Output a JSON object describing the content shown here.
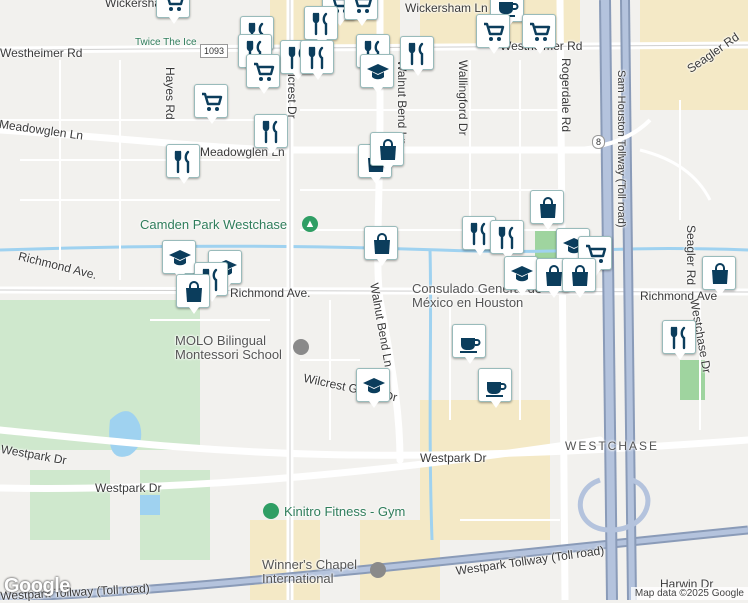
{
  "map": {
    "roads": [
      {
        "name": "Westheimer Rd"
      },
      {
        "name": "Wickersham Ln"
      },
      {
        "name": "Wickersham Ln"
      },
      {
        "name": "Westheimer Rd"
      },
      {
        "name": "Meadowglen Ln"
      },
      {
        "name": "Meadowglen Ln"
      },
      {
        "name": "Hayes Rd"
      },
      {
        "name": "Wilcrest Dr"
      },
      {
        "name": "Walnut Bend Ln"
      },
      {
        "name": "Wallingford Dr"
      },
      {
        "name": "Rogerdale Rd"
      },
      {
        "name": "Sam Houston Tollway (Toll road)"
      },
      {
        "name": "Seagler Rd"
      },
      {
        "name": "Seagler Rd"
      },
      {
        "name": "Richmond Ave."
      },
      {
        "name": "Richmond Ave."
      },
      {
        "name": "Richmond Ave"
      },
      {
        "name": "Walnut Bend Ln"
      },
      {
        "name": "Wilcrest Green Dr"
      },
      {
        "name": "Westpark Dr"
      },
      {
        "name": "Westpark Dr"
      },
      {
        "name": "Westpark Dr"
      },
      {
        "name": "Westpark Tollway (Toll road)"
      },
      {
        "name": "Westpark Tollway (Toll road)"
      },
      {
        "name": "Harwin Dr"
      },
      {
        "name": "Westchase Dr"
      }
    ],
    "shields": [
      "1093",
      "8"
    ],
    "places": [
      {
        "name": "Twice The Ice"
      },
      {
        "name": "Camden Park Westchase"
      },
      {
        "name": "Consulado General de México en Houston"
      },
      {
        "name": "MOLO Bilingual Montessori School"
      },
      {
        "name": "Kinitro Fitness - Gym"
      },
      {
        "name": "Winner's Chapel International"
      }
    ],
    "area_label": "WESTCHASE",
    "markers": [
      {
        "type": "shopping-cart"
      },
      {
        "type": "shopping-cart"
      },
      {
        "type": "restaurant"
      },
      {
        "type": "shopping-cart"
      },
      {
        "type": "coffee"
      },
      {
        "type": "shopping-cart"
      },
      {
        "type": "shopping-cart"
      },
      {
        "type": "restaurant"
      },
      {
        "type": "restaurant"
      },
      {
        "type": "restaurant"
      },
      {
        "type": "restaurant"
      },
      {
        "type": "restaurant"
      },
      {
        "type": "restaurant"
      },
      {
        "type": "school"
      },
      {
        "type": "shopping-cart"
      },
      {
        "type": "shopping-cart"
      },
      {
        "type": "restaurant"
      },
      {
        "type": "restaurant"
      },
      {
        "type": "shopping-bag"
      },
      {
        "type": "shopping-bag"
      },
      {
        "type": "shopping-bag"
      },
      {
        "type": "shopping-bag"
      },
      {
        "type": "school"
      },
      {
        "type": "school"
      },
      {
        "type": "restaurant"
      },
      {
        "type": "shopping-bag"
      },
      {
        "type": "restaurant"
      },
      {
        "type": "restaurant"
      },
      {
        "type": "school"
      },
      {
        "type": "shopping-cart"
      },
      {
        "type": "school"
      },
      {
        "type": "shopping-bag"
      },
      {
        "type": "shopping-bag"
      },
      {
        "type": "shopping-bag"
      },
      {
        "type": "restaurant"
      },
      {
        "type": "coffee"
      },
      {
        "type": "coffee"
      },
      {
        "type": "school"
      }
    ],
    "google_logo": "Google",
    "attribution": "Map data ©2025 Google"
  }
}
